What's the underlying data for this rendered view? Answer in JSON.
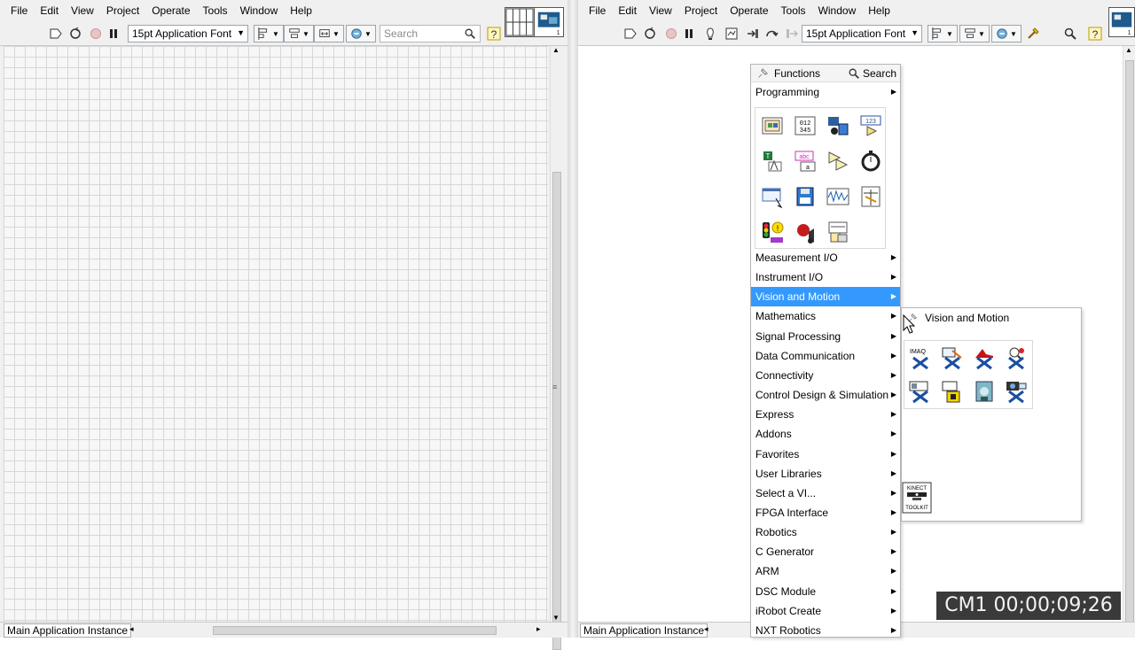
{
  "menus": [
    "File",
    "Edit",
    "View",
    "Project",
    "Operate",
    "Tools",
    "Window",
    "Help"
  ],
  "toolbar": {
    "font_label": "15pt Application Font",
    "search_placeholder": "Search"
  },
  "status": {
    "front_instance": "Main Application Instance",
    "block_instance": "Main Application Instance"
  },
  "palette": {
    "title": "Functions",
    "search_label": "Search",
    "first_category": "Programming",
    "categories": [
      "Measurement I/O",
      "Instrument I/O",
      "Vision and Motion",
      "Mathematics",
      "Signal Processing",
      "Data Communication",
      "Connectivity",
      "Control Design & Simulation",
      "Express",
      "Addons",
      "Favorites",
      "User Libraries",
      "Select a VI...",
      "FPGA Interface",
      "Robotics",
      "C Generator",
      "ARM",
      "DSC Module",
      "iRobot Create",
      "NXT Robotics"
    ],
    "selected_category": "Vision and Motion",
    "icons": [
      "cluster-icon",
      "array-icon",
      "structures-icon",
      "numeric-icon",
      "boolean-icon",
      "string-icon",
      "comparison-icon",
      "timing-icon",
      "dialog-icon",
      "file-io-icon",
      "waveform-icon",
      "app-control-icon",
      "sync-icon",
      "graphics-sound-icon",
      "report-icon",
      "empty-slot"
    ]
  },
  "subpalette": {
    "title": "Vision and Motion",
    "icons": [
      "imaq-icon",
      "vision-utilities-icon",
      "image-processing-icon",
      "machine-vision-icon",
      "vision-express-icon",
      "imaq-io-icon",
      "motion-icon",
      "camera-icon"
    ],
    "kinect_label": "KINECT TOOLKIT"
  },
  "overlay": {
    "timecode": "CM1 00;00;09;26"
  },
  "colors": {
    "selection": "#3399ff",
    "grid_line": "#d7d7d7"
  }
}
